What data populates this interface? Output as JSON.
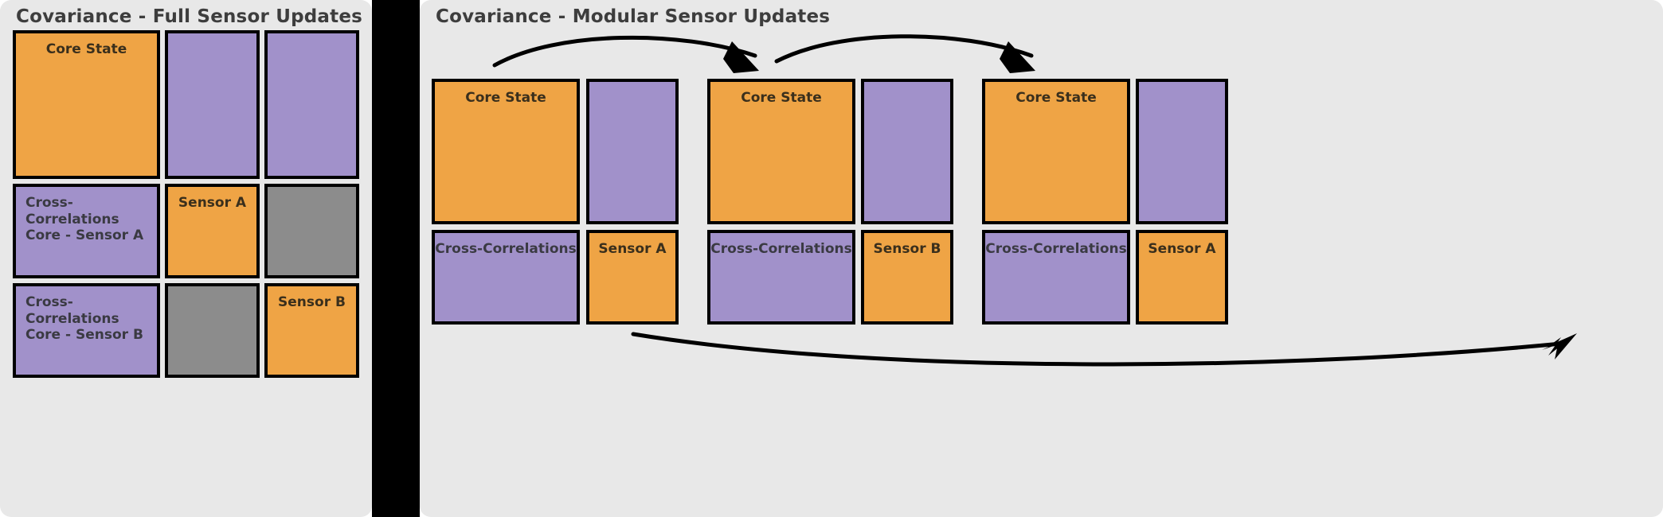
{
  "colors": {
    "panel_bg": "#e8e8e8",
    "orange": "#efa445",
    "purple": "#a191ca",
    "gray": "#8c8c8c",
    "outline": "#000000",
    "title_text": "#3d3d3d",
    "divider": "#000000"
  },
  "left_panel": {
    "title": "Covariance - Full Sensor Updates",
    "matrix": {
      "rows": [
        [
          {
            "label": "Core State",
            "color": "orange",
            "align": "center"
          },
          {
            "label": "",
            "color": "purple",
            "align": "center"
          },
          {
            "label": "",
            "color": "purple",
            "align": "center"
          }
        ],
        [
          {
            "label": "Cross-Correlations\nCore - Sensor A",
            "color": "purple",
            "align": "left"
          },
          {
            "label": "Sensor A",
            "color": "orange",
            "align": "center"
          },
          {
            "label": "",
            "color": "gray",
            "align": "center"
          }
        ],
        [
          {
            "label": "Cross-Correlations\nCore - Sensor B",
            "color": "purple",
            "align": "left"
          },
          {
            "label": "",
            "color": "gray",
            "align": "center"
          },
          {
            "label": "Sensor B",
            "color": "orange",
            "align": "center"
          }
        ]
      ]
    }
  },
  "right_panel": {
    "title": "Covariance - Modular Sensor Updates",
    "groups": [
      {
        "name": "modular-block-1",
        "rows": [
          [
            {
              "label": "Core State",
              "color": "orange",
              "align": "center"
            },
            {
              "label": "",
              "color": "purple",
              "align": "center"
            }
          ],
          [
            {
              "label": "Cross-Correlations",
              "color": "purple",
              "align": "center"
            },
            {
              "label": "Sensor A",
              "color": "orange",
              "align": "center"
            }
          ]
        ]
      },
      {
        "name": "modular-block-2",
        "rows": [
          [
            {
              "label": "Core State",
              "color": "orange",
              "align": "center"
            },
            {
              "label": "",
              "color": "purple",
              "align": "center"
            }
          ],
          [
            {
              "label": "Cross-Correlations",
              "color": "purple",
              "align": "center"
            },
            {
              "label": "Sensor B",
              "color": "orange",
              "align": "center"
            }
          ]
        ]
      },
      {
        "name": "modular-block-3",
        "rows": [
          [
            {
              "label": "Core State",
              "color": "orange",
              "align": "center"
            },
            {
              "label": "",
              "color": "purple",
              "align": "center"
            }
          ],
          [
            {
              "label": "Cross-Correlations",
              "color": "purple",
              "align": "center"
            },
            {
              "label": "Sensor A",
              "color": "orange",
              "align": "center"
            }
          ]
        ]
      }
    ],
    "flow_arrows": [
      {
        "name": "arrow-block1-to-block2",
        "direction": "right",
        "position": "above"
      },
      {
        "name": "arrow-block2-to-block3",
        "direction": "right",
        "position": "above"
      },
      {
        "name": "arrow-block1-to-block3",
        "direction": "right",
        "position": "below"
      }
    ]
  }
}
